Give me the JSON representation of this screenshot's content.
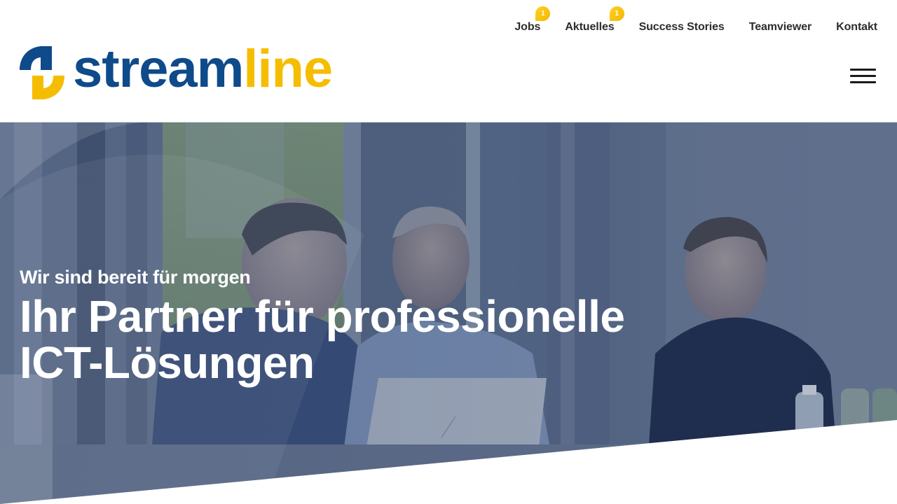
{
  "brand": {
    "name_part1": "stream",
    "name_part2": "line",
    "colors": {
      "primary_blue": "#0f4a8a",
      "accent_yellow": "#f5bd00"
    }
  },
  "topnav": {
    "items": [
      {
        "label": "Jobs",
        "badge": "1"
      },
      {
        "label": "Aktuelles",
        "badge": "1"
      },
      {
        "label": "Success Stories"
      },
      {
        "label": "Teamviewer"
      },
      {
        "label": "Kontakt"
      }
    ]
  },
  "menu": {
    "icon": "hamburger-menu-icon"
  },
  "hero": {
    "subtitle": "Wir sind bereit für morgen",
    "headline_line1": "Ihr Partner für professionelle",
    "headline_line2": "ICT-Lösungen",
    "image": "three-men-meeting-at-table-with-laptop"
  }
}
